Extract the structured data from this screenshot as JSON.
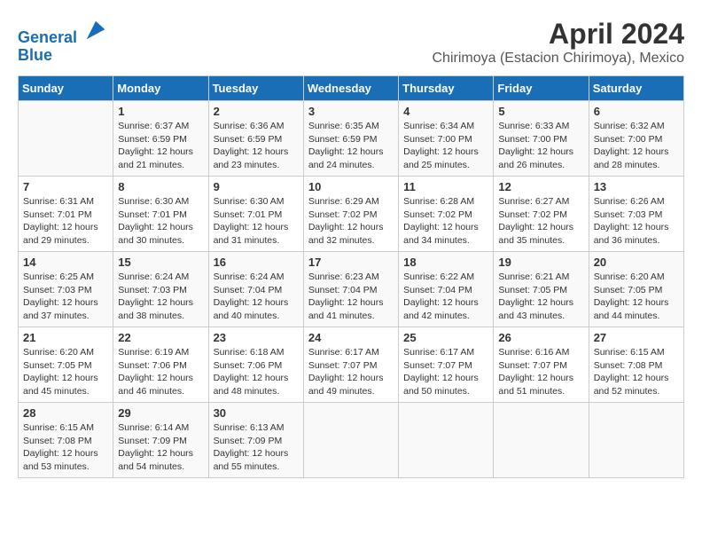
{
  "header": {
    "logo_line1": "General",
    "logo_line2": "Blue",
    "month": "April 2024",
    "location": "Chirimoya (Estacion Chirimoya), Mexico"
  },
  "days_of_week": [
    "Sunday",
    "Monday",
    "Tuesday",
    "Wednesday",
    "Thursday",
    "Friday",
    "Saturday"
  ],
  "weeks": [
    [
      {
        "day": "",
        "sunrise": "",
        "sunset": "",
        "daylight": ""
      },
      {
        "day": "1",
        "sunrise": "Sunrise: 6:37 AM",
        "sunset": "Sunset: 6:59 PM",
        "daylight": "Daylight: 12 hours and 21 minutes."
      },
      {
        "day": "2",
        "sunrise": "Sunrise: 6:36 AM",
        "sunset": "Sunset: 6:59 PM",
        "daylight": "Daylight: 12 hours and 23 minutes."
      },
      {
        "day": "3",
        "sunrise": "Sunrise: 6:35 AM",
        "sunset": "Sunset: 6:59 PM",
        "daylight": "Daylight: 12 hours and 24 minutes."
      },
      {
        "day": "4",
        "sunrise": "Sunrise: 6:34 AM",
        "sunset": "Sunset: 7:00 PM",
        "daylight": "Daylight: 12 hours and 25 minutes."
      },
      {
        "day": "5",
        "sunrise": "Sunrise: 6:33 AM",
        "sunset": "Sunset: 7:00 PM",
        "daylight": "Daylight: 12 hours and 26 minutes."
      },
      {
        "day": "6",
        "sunrise": "Sunrise: 6:32 AM",
        "sunset": "Sunset: 7:00 PM",
        "daylight": "Daylight: 12 hours and 28 minutes."
      }
    ],
    [
      {
        "day": "7",
        "sunrise": "Sunrise: 6:31 AM",
        "sunset": "Sunset: 7:01 PM",
        "daylight": "Daylight: 12 hours and 29 minutes."
      },
      {
        "day": "8",
        "sunrise": "Sunrise: 6:30 AM",
        "sunset": "Sunset: 7:01 PM",
        "daylight": "Daylight: 12 hours and 30 minutes."
      },
      {
        "day": "9",
        "sunrise": "Sunrise: 6:30 AM",
        "sunset": "Sunset: 7:01 PM",
        "daylight": "Daylight: 12 hours and 31 minutes."
      },
      {
        "day": "10",
        "sunrise": "Sunrise: 6:29 AM",
        "sunset": "Sunset: 7:02 PM",
        "daylight": "Daylight: 12 hours and 32 minutes."
      },
      {
        "day": "11",
        "sunrise": "Sunrise: 6:28 AM",
        "sunset": "Sunset: 7:02 PM",
        "daylight": "Daylight: 12 hours and 34 minutes."
      },
      {
        "day": "12",
        "sunrise": "Sunrise: 6:27 AM",
        "sunset": "Sunset: 7:02 PM",
        "daylight": "Daylight: 12 hours and 35 minutes."
      },
      {
        "day": "13",
        "sunrise": "Sunrise: 6:26 AM",
        "sunset": "Sunset: 7:03 PM",
        "daylight": "Daylight: 12 hours and 36 minutes."
      }
    ],
    [
      {
        "day": "14",
        "sunrise": "Sunrise: 6:25 AM",
        "sunset": "Sunset: 7:03 PM",
        "daylight": "Daylight: 12 hours and 37 minutes."
      },
      {
        "day": "15",
        "sunrise": "Sunrise: 6:24 AM",
        "sunset": "Sunset: 7:03 PM",
        "daylight": "Daylight: 12 hours and 38 minutes."
      },
      {
        "day": "16",
        "sunrise": "Sunrise: 6:24 AM",
        "sunset": "Sunset: 7:04 PM",
        "daylight": "Daylight: 12 hours and 40 minutes."
      },
      {
        "day": "17",
        "sunrise": "Sunrise: 6:23 AM",
        "sunset": "Sunset: 7:04 PM",
        "daylight": "Daylight: 12 hours and 41 minutes."
      },
      {
        "day": "18",
        "sunrise": "Sunrise: 6:22 AM",
        "sunset": "Sunset: 7:04 PM",
        "daylight": "Daylight: 12 hours and 42 minutes."
      },
      {
        "day": "19",
        "sunrise": "Sunrise: 6:21 AM",
        "sunset": "Sunset: 7:05 PM",
        "daylight": "Daylight: 12 hours and 43 minutes."
      },
      {
        "day": "20",
        "sunrise": "Sunrise: 6:20 AM",
        "sunset": "Sunset: 7:05 PM",
        "daylight": "Daylight: 12 hours and 44 minutes."
      }
    ],
    [
      {
        "day": "21",
        "sunrise": "Sunrise: 6:20 AM",
        "sunset": "Sunset: 7:05 PM",
        "daylight": "Daylight: 12 hours and 45 minutes."
      },
      {
        "day": "22",
        "sunrise": "Sunrise: 6:19 AM",
        "sunset": "Sunset: 7:06 PM",
        "daylight": "Daylight: 12 hours and 46 minutes."
      },
      {
        "day": "23",
        "sunrise": "Sunrise: 6:18 AM",
        "sunset": "Sunset: 7:06 PM",
        "daylight": "Daylight: 12 hours and 48 minutes."
      },
      {
        "day": "24",
        "sunrise": "Sunrise: 6:17 AM",
        "sunset": "Sunset: 7:07 PM",
        "daylight": "Daylight: 12 hours and 49 minutes."
      },
      {
        "day": "25",
        "sunrise": "Sunrise: 6:17 AM",
        "sunset": "Sunset: 7:07 PM",
        "daylight": "Daylight: 12 hours and 50 minutes."
      },
      {
        "day": "26",
        "sunrise": "Sunrise: 6:16 AM",
        "sunset": "Sunset: 7:07 PM",
        "daylight": "Daylight: 12 hours and 51 minutes."
      },
      {
        "day": "27",
        "sunrise": "Sunrise: 6:15 AM",
        "sunset": "Sunset: 7:08 PM",
        "daylight": "Daylight: 12 hours and 52 minutes."
      }
    ],
    [
      {
        "day": "28",
        "sunrise": "Sunrise: 6:15 AM",
        "sunset": "Sunset: 7:08 PM",
        "daylight": "Daylight: 12 hours and 53 minutes."
      },
      {
        "day": "29",
        "sunrise": "Sunrise: 6:14 AM",
        "sunset": "Sunset: 7:09 PM",
        "daylight": "Daylight: 12 hours and 54 minutes."
      },
      {
        "day": "30",
        "sunrise": "Sunrise: 6:13 AM",
        "sunset": "Sunset: 7:09 PM",
        "daylight": "Daylight: 12 hours and 55 minutes."
      },
      {
        "day": "",
        "sunrise": "",
        "sunset": "",
        "daylight": ""
      },
      {
        "day": "",
        "sunrise": "",
        "sunset": "",
        "daylight": ""
      },
      {
        "day": "",
        "sunrise": "",
        "sunset": "",
        "daylight": ""
      },
      {
        "day": "",
        "sunrise": "",
        "sunset": "",
        "daylight": ""
      }
    ]
  ]
}
